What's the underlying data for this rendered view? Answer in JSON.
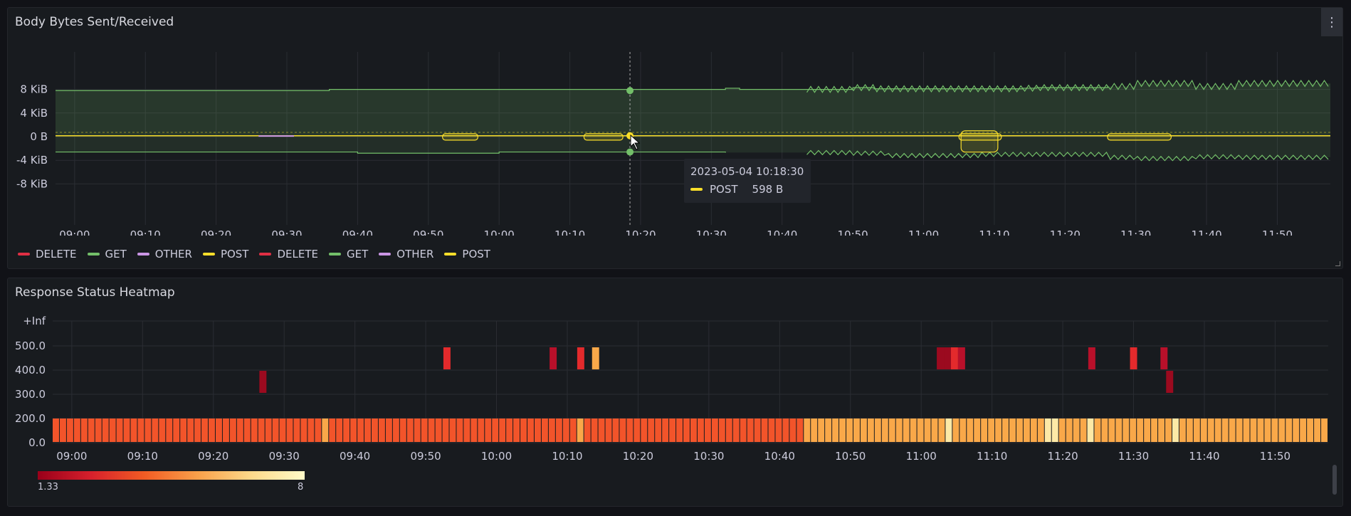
{
  "panel1": {
    "title": "Body Bytes Sent/Received",
    "menu_icon": "more-vertical-icon",
    "legend": [
      {
        "label": "DELETE",
        "color": "#e02f44"
      },
      {
        "label": "GET",
        "color": "#73bf69"
      },
      {
        "label": "OTHER",
        "color": "#ca95e5"
      },
      {
        "label": "POST",
        "color": "#fade2a"
      },
      {
        "label": "DELETE",
        "color": "#e02f44"
      },
      {
        "label": "GET",
        "color": "#73bf69"
      },
      {
        "label": "OTHER",
        "color": "#ca95e5"
      },
      {
        "label": "POST",
        "color": "#fade2a"
      }
    ],
    "tooltip": {
      "time": "2023-05-04 10:18:30",
      "series": "POST",
      "value": "598 B"
    }
  },
  "panel2": {
    "title": "Response Status Heatmap",
    "colorbar_min": "1.33",
    "colorbar_max": "8"
  },
  "colors": {
    "get": "#73bf69",
    "post": "#fade2a",
    "other": "#ca95e5",
    "delete": "#e02f44"
  },
  "chart_data": [
    {
      "type": "area",
      "title": "Body Bytes Sent/Received",
      "y_ticks": [
        "8 KiB",
        "4 KiB",
        "0 B",
        "-4 KiB",
        "-8 KiB"
      ],
      "x_ticks": [
        "09:00",
        "09:10",
        "09:20",
        "09:30",
        "09:40",
        "09:50",
        "10:00",
        "10:10",
        "10:20",
        "10:30",
        "10:40",
        "10:50",
        "11:00",
        "11:10",
        "11:20",
        "11:30",
        "11:40",
        "11:50"
      ],
      "ylim_kib": [
        -10,
        12
      ],
      "x_start_min": 537.3,
      "x_end_min": 717.5,
      "series": [
        {
          "name": "GET",
          "color": "#73bf69",
          "direction": "sent",
          "x": [
            537.3,
            575,
            576,
            600,
            632,
            634,
            650,
            653,
            674,
            676,
            686,
            690,
            698,
            704,
            717.5
          ],
          "y_kib": [
            7.8,
            7.8,
            8.0,
            8.0,
            8.2,
            8.0,
            8.3,
            8.1,
            8.2,
            8.3,
            8.5,
            9.0,
            8.5,
            9.0,
            8.0
          ]
        },
        {
          "name": "GET",
          "color": "#73bf69",
          "direction": "received",
          "x": [
            537.3,
            575,
            580,
            600,
            632,
            650,
            655,
            668,
            686,
            690,
            698,
            704,
            717.5
          ],
          "y_kib": [
            -2.6,
            -2.6,
            -2.8,
            -2.6,
            -2.7,
            -2.8,
            -3.2,
            -3.0,
            -3.5,
            -3.7,
            -3.4,
            -3.5,
            -2.6
          ]
        },
        {
          "name": "POST",
          "color": "#fade2a",
          "direction": "sent",
          "x": [
            537.3,
            717.5
          ],
          "y_kib": [
            0.15,
            0.15
          ]
        },
        {
          "name": "OTHER",
          "color": "#ca95e5",
          "direction": "sent",
          "x": [
            566,
            571
          ],
          "y_kib": [
            0.1,
            0.1
          ]
        }
      ]
    },
    {
      "type": "heatmap",
      "title": "Response Status Heatmap",
      "y_ticks": [
        "+Inf",
        "500.0",
        "400.0",
        "300.0",
        "200.0",
        "0.0"
      ],
      "x_ticks": [
        "09:00",
        "09:10",
        "09:20",
        "09:30",
        "09:40",
        "09:50",
        "10:00",
        "10:10",
        "10:20",
        "10:30",
        "10:40",
        "10:50",
        "11:00",
        "11:10",
        "11:20",
        "11:30",
        "11:40",
        "11:50"
      ],
      "color_range": [
        1.33,
        8
      ],
      "base_row": [
        {
          "from": 537.3,
          "to": 643,
          "level": "high-orange"
        },
        {
          "from": 643,
          "to": 717.5,
          "level": "light-orange"
        }
      ],
      "highlights_200": [
        575.6,
        611.2,
        663.1,
        677.3,
        678.1,
        683.6,
        695.8
      ],
      "cells": [
        {
          "t": 566.5,
          "row": "300-400",
          "value": 1.5
        },
        {
          "t": 592.5,
          "row": "400-500",
          "value": 2.5
        },
        {
          "t": 607.5,
          "row": "400-500",
          "value": 1.8
        },
        {
          "t": 611.4,
          "row": "400-500",
          "value": 2.7
        },
        {
          "t": 613.5,
          "row": "400-500",
          "value": 5.0
        },
        {
          "t": 662.2,
          "row": "400-500",
          "value": 1.6
        },
        {
          "t": 663.2,
          "row": "400-500",
          "value": 1.5
        },
        {
          "t": 664.2,
          "row": "400-500",
          "value": 2.5
        },
        {
          "t": 665.2,
          "row": "400-500",
          "value": 1.8
        },
        {
          "t": 683.6,
          "row": "400-500",
          "value": 1.8
        },
        {
          "t": 689.5,
          "row": "400-500",
          "value": 2.5
        },
        {
          "t": 693.8,
          "row": "400-500",
          "value": 1.8
        },
        {
          "t": 694.6,
          "row": "300-400",
          "value": 1.6
        }
      ]
    }
  ]
}
